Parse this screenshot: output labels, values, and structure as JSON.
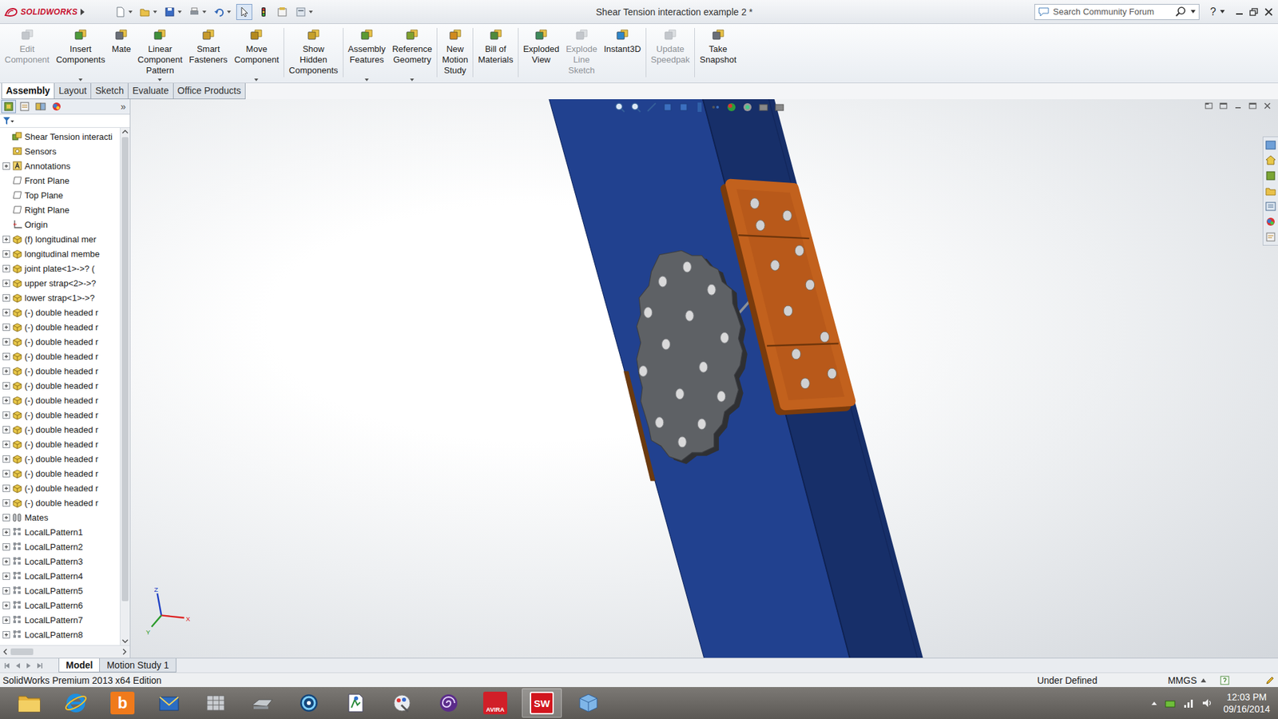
{
  "window": {
    "title": "Shear Tension interaction example 2 *",
    "logo": "SOLIDWORKS"
  },
  "search": {
    "placeholder": "Search Community Forum",
    "help": "?"
  },
  "ribbon": [
    {
      "lines": [
        "Edit",
        "Component"
      ],
      "disabled": true,
      "dropdown": false,
      "group": 1
    },
    {
      "lines": [
        "Insert",
        "Components"
      ],
      "disabled": false,
      "dropdown": true,
      "group": 1
    },
    {
      "lines": [
        "Mate"
      ],
      "disabled": false,
      "dropdown": false,
      "group": 1
    },
    {
      "lines": [
        "Linear",
        "Component",
        "Pattern"
      ],
      "disabled": false,
      "dropdown": true,
      "group": 1
    },
    {
      "lines": [
        "Smart",
        "Fasteners"
      ],
      "disabled": false,
      "dropdown": false,
      "group": 1
    },
    {
      "lines": [
        "Move",
        "Component"
      ],
      "disabled": false,
      "dropdown": true,
      "group": 1
    },
    {
      "lines": [
        "Show",
        "Hidden",
        "Components"
      ],
      "disabled": false,
      "dropdown": false,
      "group": 2
    },
    {
      "lines": [
        "Assembly",
        "Features"
      ],
      "disabled": false,
      "dropdown": true,
      "group": 3
    },
    {
      "lines": [
        "Reference",
        "Geometry"
      ],
      "disabled": false,
      "dropdown": true,
      "group": 3
    },
    {
      "lines": [
        "New",
        "Motion",
        "Study"
      ],
      "disabled": false,
      "dropdown": false,
      "group": 4
    },
    {
      "lines": [
        "Bill of",
        "Materials"
      ],
      "disabled": false,
      "dropdown": false,
      "group": 5
    },
    {
      "lines": [
        "Exploded",
        "View"
      ],
      "disabled": false,
      "dropdown": false,
      "group": 6
    },
    {
      "lines": [
        "Explode",
        "Line",
        "Sketch"
      ],
      "disabled": true,
      "dropdown": false,
      "group": 6
    },
    {
      "lines": [
        "Instant3D"
      ],
      "disabled": false,
      "dropdown": false,
      "group": 6
    },
    {
      "lines": [
        "Update",
        "Speedpak"
      ],
      "disabled": true,
      "dropdown": false,
      "group": 7
    },
    {
      "lines": [
        "Take",
        "Snapshot"
      ],
      "disabled": false,
      "dropdown": false,
      "group": 8
    }
  ],
  "command_tabs": [
    {
      "label": "Assembly",
      "selected": true
    },
    {
      "label": "Layout",
      "selected": false
    },
    {
      "label": "Sketch",
      "selected": false
    },
    {
      "label": "Evaluate",
      "selected": false
    },
    {
      "label": "Office Products",
      "selected": false
    }
  ],
  "tree": {
    "more": "»",
    "scrollbar_level": 0.93,
    "items": [
      {
        "text": "Shear Tension interacti",
        "kind": "assembly",
        "collapsible": false
      },
      {
        "text": "Sensors",
        "kind": "sensors",
        "collapsible": false
      },
      {
        "text": "Annotations",
        "kind": "annotations",
        "collapsible": true
      },
      {
        "text": "Front Plane",
        "kind": "plane",
        "collapsible": false
      },
      {
        "text": "Top Plane",
        "kind": "plane",
        "collapsible": false
      },
      {
        "text": "Right Plane",
        "kind": "plane",
        "collapsible": false
      },
      {
        "text": "Origin",
        "kind": "origin",
        "collapsible": false
      },
      {
        "text": "(f) longitudinal mer",
        "kind": "part",
        "collapsible": true
      },
      {
        "text": "longitudinal membe",
        "kind": "part",
        "collapsible": true
      },
      {
        "text": "joint plate<1>->? (",
        "kind": "part",
        "collapsible": true
      },
      {
        "text": "upper strap<2>->?",
        "kind": "part",
        "collapsible": true
      },
      {
        "text": "lower strap<1>->?",
        "kind": "part",
        "collapsible": true
      },
      {
        "text": "(-) double headed r",
        "kind": "part",
        "collapsible": true
      },
      {
        "text": "(-) double headed r",
        "kind": "part",
        "collapsible": true
      },
      {
        "text": "(-) double headed r",
        "kind": "part",
        "collapsible": true
      },
      {
        "text": "(-) double headed r",
        "kind": "part",
        "collapsible": true
      },
      {
        "text": "(-) double headed r",
        "kind": "part",
        "collapsible": true
      },
      {
        "text": "(-) double headed r",
        "kind": "part",
        "collapsible": true
      },
      {
        "text": "(-) double headed r",
        "kind": "part",
        "collapsible": true
      },
      {
        "text": "(-) double headed r",
        "kind": "part",
        "collapsible": true
      },
      {
        "text": "(-) double headed r",
        "kind": "part",
        "collapsible": true
      },
      {
        "text": "(-) double headed r",
        "kind": "part",
        "collapsible": true
      },
      {
        "text": "(-) double headed r",
        "kind": "part",
        "collapsible": true
      },
      {
        "text": "(-) double headed r",
        "kind": "part",
        "collapsible": true
      },
      {
        "text": "(-) double headed r",
        "kind": "part",
        "collapsible": true
      },
      {
        "text": "(-) double headed r",
        "kind": "part",
        "collapsible": true
      },
      {
        "text": "Mates",
        "kind": "mates",
        "collapsible": true
      },
      {
        "text": "LocalLPattern1",
        "kind": "pattern",
        "collapsible": true
      },
      {
        "text": "LocalLPattern2",
        "kind": "pattern",
        "collapsible": true
      },
      {
        "text": "LocalLPattern3",
        "kind": "pattern",
        "collapsible": true
      },
      {
        "text": "LocalLPattern4",
        "kind": "pattern",
        "collapsible": true
      },
      {
        "text": "LocalLPattern5",
        "kind": "pattern",
        "collapsible": true
      },
      {
        "text": "LocalLPattern6",
        "kind": "pattern",
        "collapsible": true
      },
      {
        "text": "LocalLPattern7",
        "kind": "pattern",
        "collapsible": true
      },
      {
        "text": "LocalLPattern8",
        "kind": "pattern",
        "collapsible": true
      }
    ]
  },
  "viewport": {
    "triad": {
      "x": "X",
      "y": "Y",
      "z": "Z"
    }
  },
  "bottom_tabs": [
    {
      "label": "Model",
      "selected": true
    },
    {
      "label": "Motion Study 1",
      "selected": false
    }
  ],
  "status_bar": {
    "product": "SolidWorks Premium 2013 x64 Edition",
    "state": "Under Defined",
    "units": "MMGS"
  },
  "taskbar": {
    "apps": [
      {
        "kind": "folder",
        "label": "",
        "active": false
      },
      {
        "kind": "ie",
        "label": "",
        "active": false
      },
      {
        "kind": "bing",
        "label": "b",
        "active": false
      },
      {
        "kind": "mail",
        "label": "",
        "active": false
      },
      {
        "kind": "grid",
        "label": "",
        "active": false
      },
      {
        "kind": "scanner",
        "label": "",
        "active": false
      },
      {
        "kind": "ring",
        "label": "",
        "active": false
      },
      {
        "kind": "map",
        "label": "",
        "active": false
      },
      {
        "kind": "paint",
        "label": "",
        "active": false
      },
      {
        "kind": "spiral",
        "label": "",
        "active": false
      },
      {
        "kind": "avira",
        "label": "AVIRA",
        "active": false
      },
      {
        "kind": "solidworks",
        "label": "SW",
        "active": true
      },
      {
        "kind": "cube",
        "label": "",
        "active": false
      }
    ],
    "time": "12:03 PM",
    "date": "09/16/2014"
  }
}
